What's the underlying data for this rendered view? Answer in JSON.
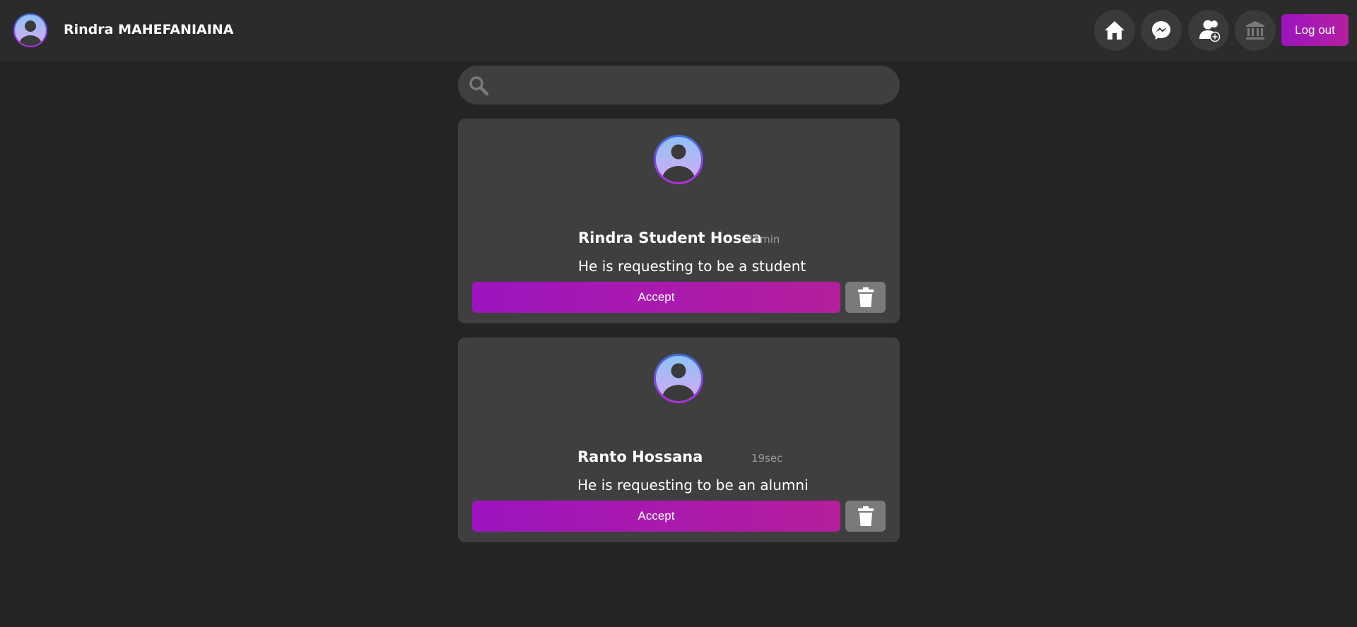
{
  "header": {
    "user_name": "Rindra MAHEFANIAINA",
    "logout_label": "Log out",
    "nav_icons": [
      "home-icon",
      "messenger-icon",
      "friend-request-icon",
      "institution-icon"
    ]
  },
  "search": {
    "placeholder": ""
  },
  "requests": [
    {
      "name": "Rindra Student Hosea",
      "time": "43min",
      "message": "He is requesting to be a student",
      "accept_label": "Accept"
    },
    {
      "name": "Ranto Hossana",
      "time": "19sec",
      "message": "He is requesting to be an alumni",
      "accept_label": "Accept"
    }
  ],
  "colors": {
    "accent_start": "#9d14bf",
    "accent_end": "#b41fa0",
    "background": "#242424",
    "card": "#3f3f3f"
  }
}
